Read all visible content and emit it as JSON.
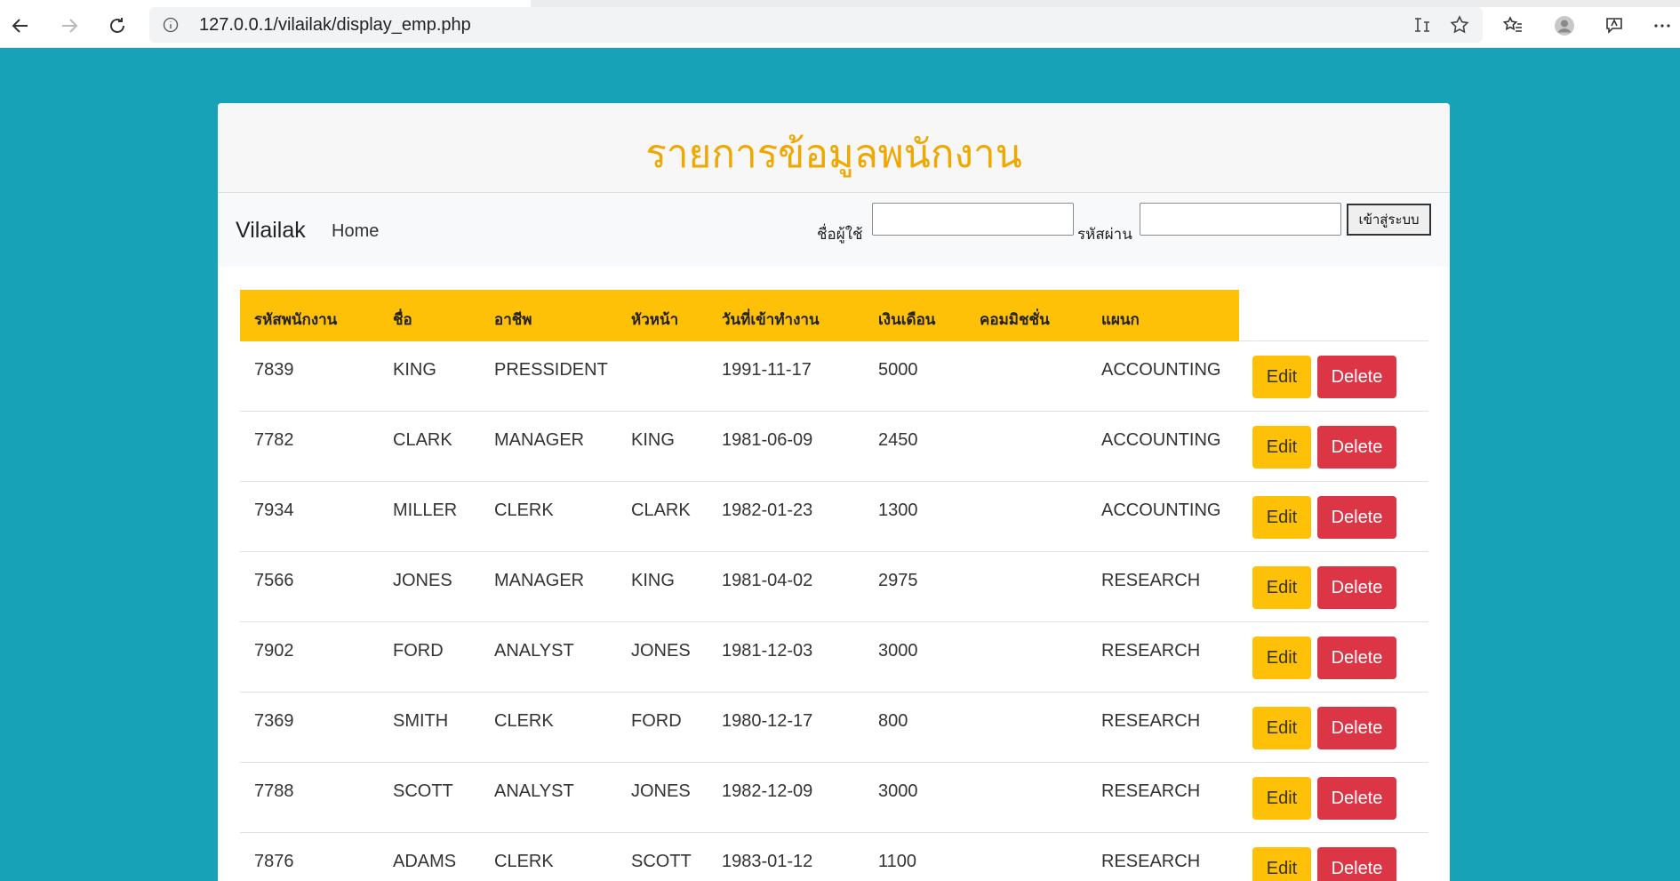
{
  "browser": {
    "url": "127.0.0.1/vilailak/display_emp.php",
    "icons": [
      "back-icon",
      "forward-icon",
      "refresh-icon",
      "info-icon",
      "read-aloud-icon",
      "favorite-star-icon",
      "favorites-icon",
      "profile-icon",
      "feedback-icon",
      "more-icon"
    ]
  },
  "header": {
    "title": "รายการข้อมูลพนักงาน"
  },
  "navbar": {
    "brand": "Vilailak",
    "home": "Home",
    "username_label": "ชื่อผู้ใช้",
    "username_value": "",
    "password_label": "รหัสผ่าน",
    "password_value": "",
    "login_button": "เข้าสู่ระบบ"
  },
  "table": {
    "columns": [
      "รหัสพนักงาน",
      "ชื่อ",
      "อาชีพ",
      "หัวหน้า",
      "วันที่เข้าทำงาน",
      "เงินเดือน",
      "คอมมิชชั่น",
      "แผนก"
    ],
    "edit_label": "Edit",
    "delete_label": "Delete",
    "rows": [
      [
        "7839",
        "KING",
        "PRESSIDENT",
        "",
        "1991-11-17",
        "5000",
        "",
        "ACCOUNTING"
      ],
      [
        "7782",
        "CLARK",
        "MANAGER",
        "KING",
        "1981-06-09",
        "2450",
        "",
        "ACCOUNTING"
      ],
      [
        "7934",
        "MILLER",
        "CLERK",
        "CLARK",
        "1982-01-23",
        "1300",
        "",
        "ACCOUNTING"
      ],
      [
        "7566",
        "JONES",
        "MANAGER",
        "KING",
        "1981-04-02",
        "2975",
        "",
        "RESEARCH"
      ],
      [
        "7902",
        "FORD",
        "ANALYST",
        "JONES",
        "1981-12-03",
        "3000",
        "",
        "RESEARCH"
      ],
      [
        "7369",
        "SMITH",
        "CLERK",
        "FORD",
        "1980-12-17",
        "800",
        "",
        "RESEARCH"
      ],
      [
        "7788",
        "SCOTT",
        "ANALYST",
        "JONES",
        "1982-12-09",
        "3000",
        "",
        "RESEARCH"
      ],
      [
        "7876",
        "ADAMS",
        "CLERK",
        "SCOTT",
        "1983-01-12",
        "1100",
        "",
        "RESEARCH"
      ]
    ]
  },
  "colors": {
    "page_bg": "#17a2b8",
    "title": "#f0a800",
    "header_row": "#ffc107",
    "edit": "#ffc107",
    "delete": "#dc3545"
  }
}
